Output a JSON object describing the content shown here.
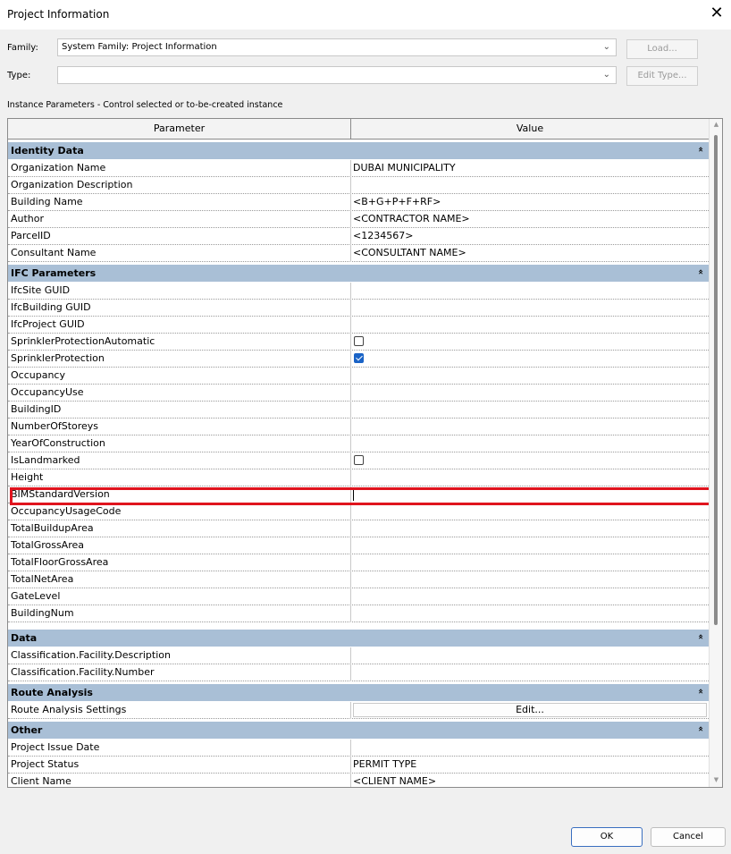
{
  "window": {
    "title": "Project Information",
    "close_glyph": "✕"
  },
  "family": {
    "label": "Family:",
    "value": "System Family: Project Information"
  },
  "type": {
    "label": "Type:",
    "value": ""
  },
  "buttons": {
    "load": "Load...",
    "edit_type": "Edit Type...",
    "ok": "OK",
    "cancel": "Cancel"
  },
  "section_label": "Instance Parameters - Control selected or to-be-created instance",
  "columns": {
    "parameter": "Parameter",
    "value": "Value"
  },
  "collapse_glyph": "»",
  "groups": {
    "identity": {
      "name": "Identity Data",
      "rows": [
        {
          "param": "Organization Name",
          "value": "DUBAI MUNICIPALITY"
        },
        {
          "param": "Organization Description",
          "value": ""
        },
        {
          "param": "Building Name",
          "value": "<B+G+P+F+RF>"
        },
        {
          "param": "Author",
          "value": "<CONTRACTOR NAME>"
        },
        {
          "param": "ParcelID",
          "value": "<1234567>"
        },
        {
          "param": "Consultant Name",
          "value": "<CONSULTANT NAME>"
        }
      ]
    },
    "ifc": {
      "name": "IFC Parameters",
      "rows": [
        {
          "param": "IfcSite GUID",
          "value": ""
        },
        {
          "param": "IfcBuilding GUID",
          "value": ""
        },
        {
          "param": "IfcProject GUID",
          "value": ""
        },
        {
          "param": "SprinklerProtectionAutomatic",
          "checked": false
        },
        {
          "param": "SprinklerProtection",
          "checked": true
        },
        {
          "param": "Occupancy",
          "value": ""
        },
        {
          "param": "OccupancyUse",
          "value": ""
        },
        {
          "param": "BuildingID",
          "value": ""
        },
        {
          "param": "NumberOfStoreys",
          "value": ""
        },
        {
          "param": "YearOfConstruction",
          "value": ""
        },
        {
          "param": "IsLandmarked",
          "checked": false
        },
        {
          "param": "Height",
          "value": ""
        },
        {
          "param": "BIMStandardVersion",
          "value": ""
        },
        {
          "param": "OccupancyUsageCode",
          "value": ""
        },
        {
          "param": "TotalBuildupArea",
          "value": ""
        },
        {
          "param": "TotalGrossArea",
          "value": ""
        },
        {
          "param": "TotalFloorGrossArea",
          "value": ""
        },
        {
          "param": "TotalNetArea",
          "value": ""
        },
        {
          "param": "GateLevel",
          "value": ""
        },
        {
          "param": "BuildingNum",
          "value": ""
        }
      ]
    },
    "data": {
      "name": "Data",
      "rows": [
        {
          "param": "Classification.Facility.Description",
          "value": ""
        },
        {
          "param": "Classification.Facility.Number",
          "value": ""
        }
      ]
    },
    "route": {
      "name": "Route Analysis",
      "rows": [
        {
          "param": "Route Analysis Settings",
          "button": "Edit..."
        }
      ]
    },
    "other": {
      "name": "Other",
      "rows": [
        {
          "param": "Project Issue Date",
          "value": ""
        },
        {
          "param": "Project Status",
          "value": "PERMIT TYPE"
        },
        {
          "param": "Client Name",
          "value": "<CLIENT NAME>"
        }
      ]
    }
  }
}
